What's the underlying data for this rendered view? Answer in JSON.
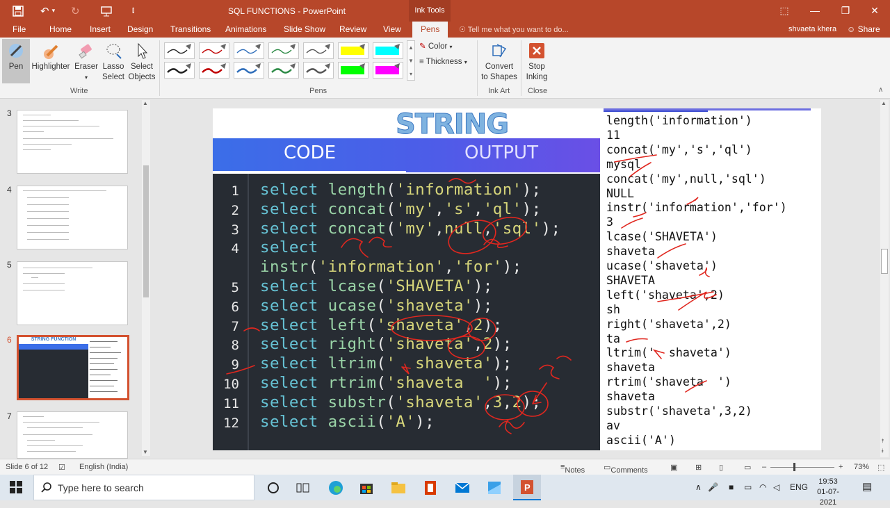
{
  "window": {
    "title": "SQL FUNCTIONS  -  PowerPoint",
    "context_tab": "Ink Tools",
    "user": "shvaeta khera",
    "share": "Share",
    "tell_me": "Tell me what you want to do..."
  },
  "tabs": [
    "File",
    "Home",
    "Insert",
    "Design",
    "Transitions",
    "Animations",
    "Slide Show",
    "Review",
    "View",
    "Pens"
  ],
  "ribbon": {
    "write": {
      "pen": "Pen",
      "highlighter": "Highlighter",
      "eraser": "Eraser",
      "lasso_1": "Lasso",
      "lasso_2": "Select",
      "select_1": "Select",
      "select_2": "Objects",
      "group": "Write"
    },
    "pens_group": "Pens",
    "color": "Color",
    "thickness": "Thickness",
    "convert_1": "Convert",
    "convert_2": "to Shapes",
    "ink_art": "Ink Art",
    "stop_1": "Stop",
    "stop_2": "Inking",
    "close": "Close",
    "pen_colors": [
      "#222222",
      "#c00000",
      "#2f6eba",
      "#2e8b47",
      "#555555",
      "#ffff00",
      "#00ffff",
      "#222222",
      "#c00000",
      "#2f6eba",
      "#2e8b47",
      "#555555",
      "#00ff00",
      "#ff00ff"
    ]
  },
  "thumbnails": [
    "3",
    "4",
    "5",
    "6",
    "7"
  ],
  "slide": {
    "heading": "STRING FUNCTION",
    "code_label": "CODE",
    "output_label": "OUTPUT",
    "line_numbers": [
      "1",
      "2",
      "3",
      "4",
      "",
      "5",
      "6",
      "7",
      "8",
      "9",
      "10",
      "11",
      "12"
    ],
    "code": [
      [
        [
          "kw",
          "select"
        ],
        [
          "pu",
          " "
        ],
        [
          "fn",
          "length"
        ],
        [
          "pu",
          "("
        ],
        [
          "st",
          "'information'"
        ],
        [
          "pu",
          ");"
        ]
      ],
      [
        [
          "kw",
          "select"
        ],
        [
          "pu",
          " "
        ],
        [
          "fn",
          "concat"
        ],
        [
          "pu",
          "("
        ],
        [
          "st",
          "'my'"
        ],
        [
          "pu",
          ","
        ],
        [
          "st",
          "'s'"
        ],
        [
          "pu",
          ","
        ],
        [
          "st",
          "'ql'"
        ],
        [
          "pu",
          ");"
        ]
      ],
      [
        [
          "kw",
          "select"
        ],
        [
          "pu",
          " "
        ],
        [
          "fn",
          "concat"
        ],
        [
          "pu",
          "("
        ],
        [
          "st",
          "'my'"
        ],
        [
          "pu",
          ","
        ],
        [
          "nm",
          "null"
        ],
        [
          "pu",
          ","
        ],
        [
          "st",
          "'sql'"
        ],
        [
          "pu",
          ");"
        ]
      ],
      [
        [
          "kw",
          "select"
        ]
      ],
      [
        [
          "fn",
          "instr"
        ],
        [
          "pu",
          "("
        ],
        [
          "st",
          "'information'"
        ],
        [
          "pu",
          ","
        ],
        [
          "st",
          "'for'"
        ],
        [
          "pu",
          ");"
        ]
      ],
      [
        [
          "kw",
          "select"
        ],
        [
          "pu",
          " "
        ],
        [
          "fn",
          "lcase"
        ],
        [
          "pu",
          "("
        ],
        [
          "st",
          "'SHAVETA'"
        ],
        [
          "pu",
          ");"
        ]
      ],
      [
        [
          "kw",
          "select"
        ],
        [
          "pu",
          " "
        ],
        [
          "fn",
          "ucase"
        ],
        [
          "pu",
          "("
        ],
        [
          "st",
          "'shaveta'"
        ],
        [
          "pu",
          ");"
        ]
      ],
      [
        [
          "kw",
          "select"
        ],
        [
          "pu",
          " "
        ],
        [
          "fn",
          "left"
        ],
        [
          "pu",
          "("
        ],
        [
          "st",
          "'shaveta'"
        ],
        [
          "pu",
          ","
        ],
        [
          "nm",
          "2"
        ],
        [
          "pu",
          ");"
        ]
      ],
      [
        [
          "kw",
          "select"
        ],
        [
          "pu",
          " "
        ],
        [
          "fn",
          "right"
        ],
        [
          "pu",
          "("
        ],
        [
          "st",
          "'shaveta'"
        ],
        [
          "pu",
          ","
        ],
        [
          "nm",
          "2"
        ],
        [
          "pu",
          ");"
        ]
      ],
      [
        [
          "kw",
          "select"
        ],
        [
          "pu",
          " "
        ],
        [
          "fn",
          "ltrim"
        ],
        [
          "pu",
          "("
        ],
        [
          "st",
          "'  shaveta'"
        ],
        [
          "pu",
          ");"
        ]
      ],
      [
        [
          "kw",
          "select"
        ],
        [
          "pu",
          " "
        ],
        [
          "fn",
          "rtrim"
        ],
        [
          "pu",
          "("
        ],
        [
          "st",
          "'shaveta  '"
        ],
        [
          "pu",
          ");"
        ]
      ],
      [
        [
          "kw",
          "select"
        ],
        [
          "pu",
          " "
        ],
        [
          "fn",
          "substr"
        ],
        [
          "pu",
          "("
        ],
        [
          "st",
          "'shaveta'"
        ],
        [
          "pu",
          ","
        ],
        [
          "nm",
          "3"
        ],
        [
          "pu",
          ","
        ],
        [
          "nm",
          "2"
        ],
        [
          "pu",
          ");"
        ]
      ],
      [
        [
          "kw",
          "select"
        ],
        [
          "pu",
          " "
        ],
        [
          "fn",
          "ascii"
        ],
        [
          "pu",
          "("
        ],
        [
          "st",
          "'A'"
        ],
        [
          "pu",
          ");"
        ]
      ]
    ],
    "output": [
      "length('information')",
      "11",
      "concat('my','s','ql')",
      "mysql",
      "concat('my',null,'sql')",
      "NULL",
      "instr('information','for')",
      "3",
      "lcase('SHAVETA')",
      "shaveta",
      "ucase('shaveta')",
      "SHAVETA",
      "left('shaveta',2)",
      "sh",
      "right('shaveta',2)",
      "ta",
      "ltrim('  shaveta')",
      "shaveta",
      "rtrim('shaveta  ')",
      "shaveta",
      "substr('shaveta',3,2)",
      "av",
      "ascii('A')"
    ]
  },
  "status": {
    "slide": "Slide 6 of 12",
    "language": "English (India)",
    "notes": "Notes",
    "comments": "Comments",
    "zoom": "73%"
  },
  "taskbar": {
    "search": "Type here to search",
    "time": "19:53",
    "date": "01-07-2021",
    "lang": "ENG"
  }
}
